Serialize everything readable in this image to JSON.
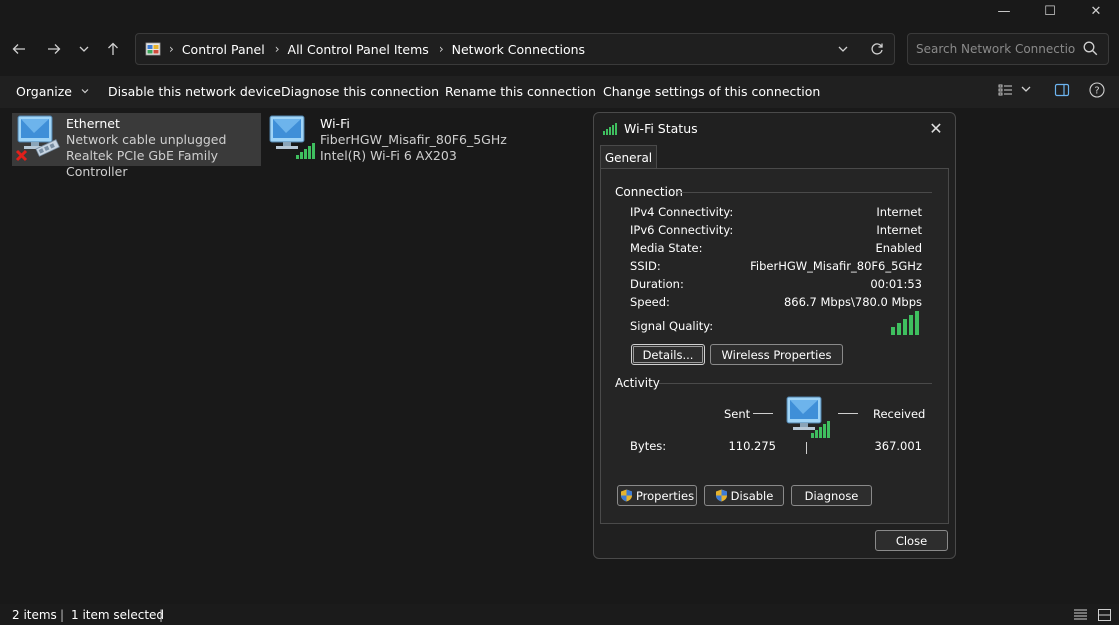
{
  "window": {
    "minimize_glyph": "—",
    "maximize_glyph": "☐",
    "close_glyph": "✕"
  },
  "nav": {
    "back_glyph": "←",
    "forward_glyph": "→",
    "recent_glyph": "⌄",
    "up_glyph": "↑"
  },
  "address": {
    "crumbs": [
      "Control Panel",
      "All Control Panel Items",
      "Network Connections"
    ],
    "separator": "›",
    "dropdown_glyph": "⌄",
    "refresh_glyph": "↻"
  },
  "search": {
    "placeholder": "Search Network Connections"
  },
  "commands": {
    "organize": "Organize",
    "organize_chevron": "⌄",
    "disable": "Disable this network device",
    "diagnose": "Diagnose this connection",
    "rename": "Rename this connection",
    "change": "Change settings of this connection",
    "view_chevron": "⌄",
    "help_glyph": "?"
  },
  "items": [
    {
      "name": "Ethernet",
      "status": "Network cable unplugged",
      "device": "Realtek PCIe GbE Family Controller"
    },
    {
      "name": "Wi-Fi",
      "status": "FiberHGW_Misafir_80F6_5GHz",
      "device": "Intel(R) Wi-Fi 6 AX203"
    }
  ],
  "statusbar": {
    "count": "2 items",
    "selected": "1 item selected"
  },
  "dialog": {
    "title": "Wi-Fi Status",
    "close_glyph": "✕",
    "tab": "General",
    "connection": {
      "heading": "Connection",
      "rows": [
        {
          "label": "IPv4 Connectivity:",
          "value": "Internet"
        },
        {
          "label": "IPv6 Connectivity:",
          "value": "Internet"
        },
        {
          "label": "Media State:",
          "value": "Enabled"
        },
        {
          "label": "SSID:",
          "value": "FiberHGW_Misafir_80F6_5GHz"
        },
        {
          "label": "Duration:",
          "value": "00:01:53"
        },
        {
          "label": "Speed:",
          "value": "866.7 Mbps\\780.0 Mbps"
        }
      ],
      "signal_label": "Signal Quality:",
      "signal_bars": 5,
      "details_button": "Details...",
      "wireless_button": "Wireless Properties"
    },
    "activity": {
      "heading": "Activity",
      "sent_label": "Sent",
      "received_label": "Received",
      "bytes_label": "Bytes:",
      "bytes_sent": "110.275",
      "bytes_received": "367.001"
    },
    "properties_button": "Properties",
    "disable_button": "Disable",
    "diagnose_button": "Diagnose",
    "close_button": "Close"
  },
  "colors": {
    "background": "#191919",
    "signal_green": "#3fbf5f",
    "monitor_blue": "#5aa8e6",
    "error_red": "#e0201b"
  }
}
